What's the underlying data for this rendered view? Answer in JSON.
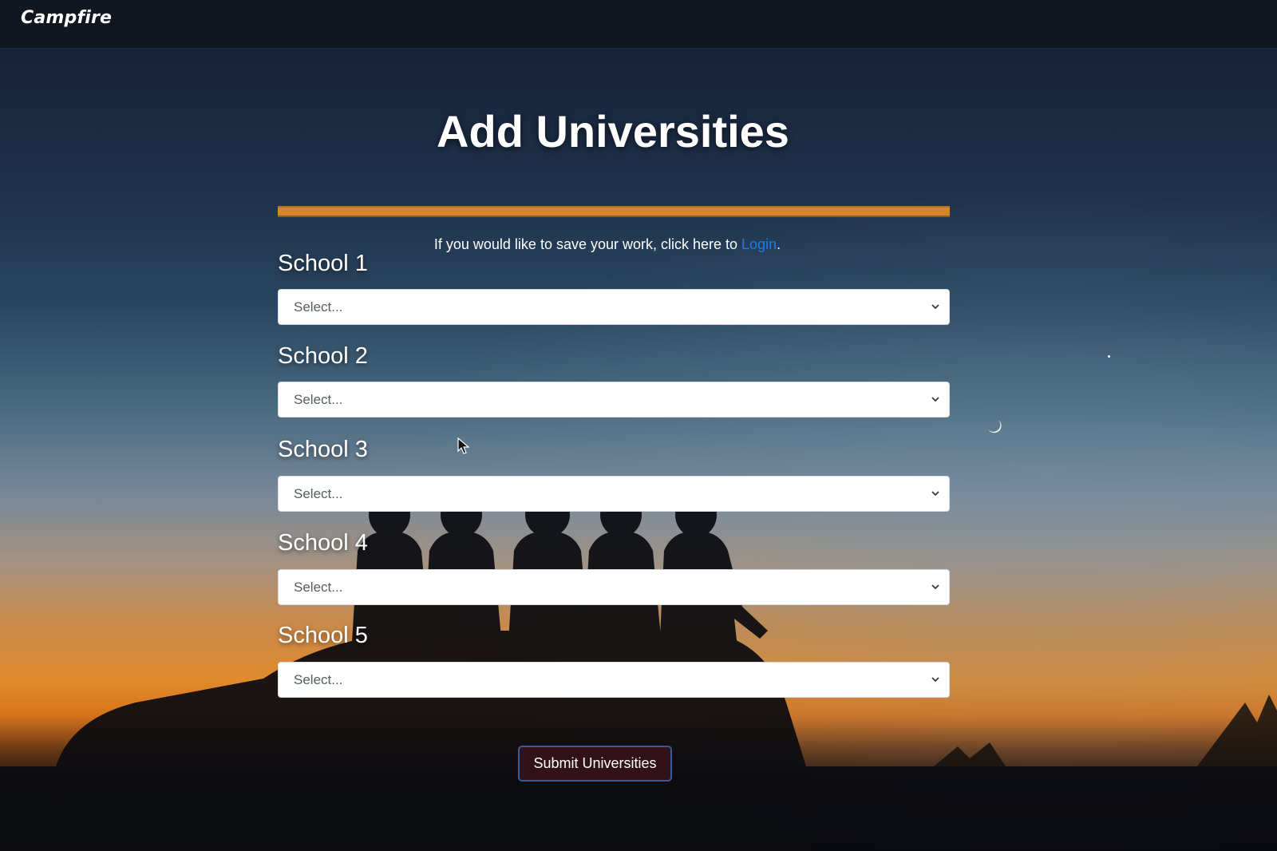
{
  "navbar": {
    "brand": "Campfire"
  },
  "main": {
    "title": "Add Universities",
    "notice": {
      "prefix": "If you would like to save your work, click here to ",
      "link_label": "Login",
      "suffix": "."
    },
    "fields": [
      {
        "label": "School 1",
        "placeholder": "Select..."
      },
      {
        "label": "School 2",
        "placeholder": "Select..."
      },
      {
        "label": "School 3",
        "placeholder": "Select..."
      },
      {
        "label": "School 4",
        "placeholder": "Select..."
      },
      {
        "label": "School 5",
        "placeholder": "Select..."
      }
    ],
    "submit_label": "Submit Universities"
  },
  "icons": {
    "select_chevron": "chevron-down-icon",
    "moon": "crescent-moon-icon",
    "cursor": "mouse-pointer-icon"
  },
  "colors": {
    "navbar_bg": "#11161f",
    "accent_bar": "#d5862a",
    "link": "#1e7cf2",
    "submit_bg": "#311218",
    "submit_border": "#3a5a9a"
  }
}
